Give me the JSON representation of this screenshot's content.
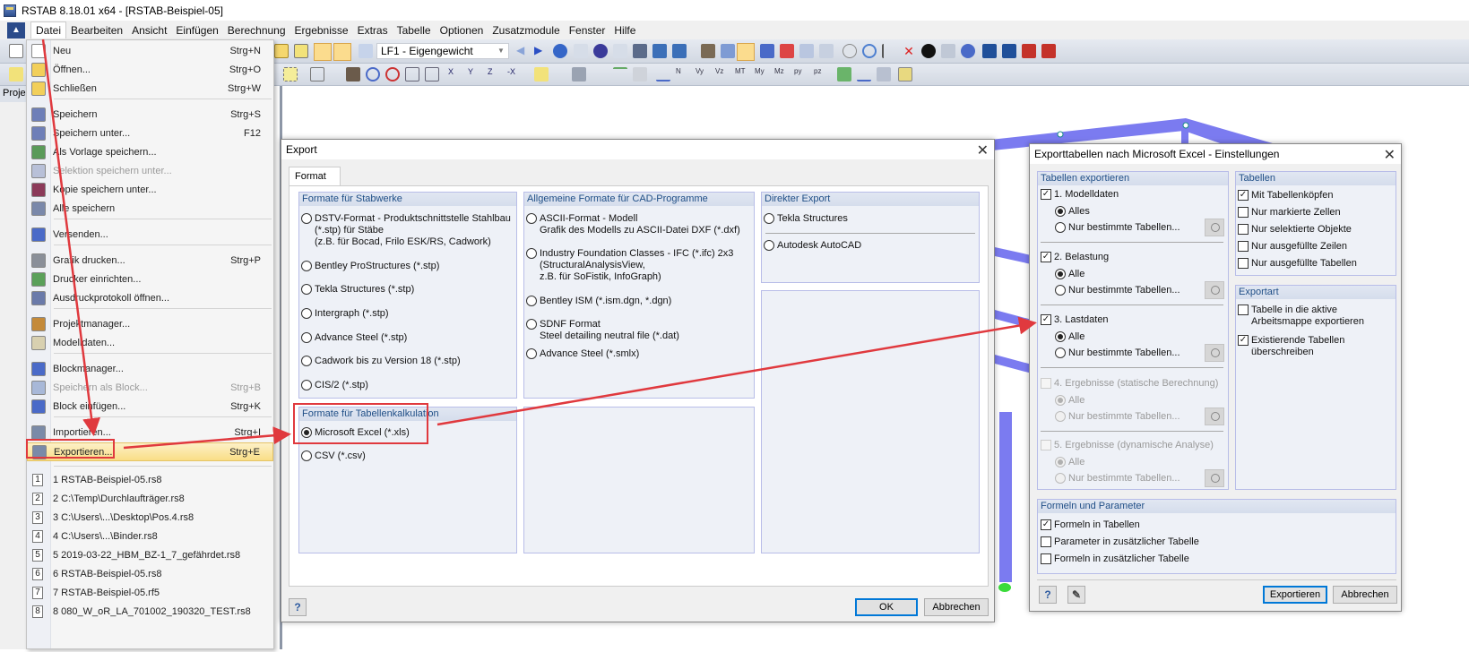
{
  "window": {
    "title": "RSTAB 8.18.01 x64 - [RSTAB-Beispiel-05]"
  },
  "menubar": {
    "items": [
      "Datei",
      "Bearbeiten",
      "Ansicht",
      "Einfügen",
      "Berechnung",
      "Ergebnisse",
      "Extras",
      "Tabelle",
      "Optionen",
      "Zusatzmodule",
      "Fenster",
      "Hilfe"
    ],
    "active": "Datei"
  },
  "toolbar": {
    "loadcase_combo": "LF1 - Eigengewicht"
  },
  "leftpanel": {
    "tab_label": "Proje"
  },
  "filemenu": {
    "items": [
      {
        "label": "Neu",
        "shortcut": "Strg+N",
        "icon": "new-file-icon"
      },
      {
        "label": "Öffnen...",
        "shortcut": "Strg+O",
        "icon": "open-folder-icon"
      },
      {
        "label": "Schließen",
        "shortcut": "Strg+W",
        "icon": "close-folder-icon"
      },
      {
        "label": "Speichern",
        "shortcut": "Strg+S",
        "icon": "save-icon"
      },
      {
        "label": "Speichern unter...",
        "shortcut": "F12",
        "icon": "save-as-icon"
      },
      {
        "label": "Als Vorlage speichern...",
        "shortcut": "",
        "icon": "save-template-icon"
      },
      {
        "label": "Selektion speichern unter...",
        "shortcut": "",
        "icon": "save-selection-icon",
        "disabled": true
      },
      {
        "label": "Kopie speichern unter...",
        "shortcut": "",
        "icon": "save-copy-icon"
      },
      {
        "label": "Alle speichern",
        "shortcut": "",
        "icon": "save-all-icon"
      },
      {
        "label": "Versenden...",
        "shortcut": "",
        "icon": "send-icon"
      },
      {
        "label": "Grafik drucken...",
        "shortcut": "Strg+P",
        "icon": "print-icon"
      },
      {
        "label": "Drucker einrichten...",
        "shortcut": "",
        "icon": "printer-setup-icon"
      },
      {
        "label": "Ausdruckprotokoll öffnen...",
        "shortcut": "",
        "icon": "printout-report-icon"
      },
      {
        "label": "Projektmanager...",
        "shortcut": "",
        "icon": "project-manager-icon"
      },
      {
        "label": "Modelldaten...",
        "shortcut": "",
        "icon": "model-data-icon"
      },
      {
        "label": "Blockmanager...",
        "shortcut": "",
        "icon": "block-manager-icon"
      },
      {
        "label": "Speichern als Block...",
        "shortcut": "Strg+B",
        "icon": "save-block-icon",
        "disabled": true
      },
      {
        "label": "Block einfügen...",
        "shortcut": "Strg+K",
        "icon": "insert-block-icon"
      },
      {
        "label": "Importieren...",
        "shortcut": "Strg+I",
        "icon": "import-icon"
      },
      {
        "label": "Exportieren...",
        "shortcut": "Strg+E",
        "icon": "export-icon",
        "highlighted": true
      }
    ],
    "recent": [
      "1 RSTAB-Beispiel-05.rs8",
      "2 C:\\Temp\\Durchlaufträger.rs8",
      "3 C:\\Users\\...\\Desktop\\Pos.4.rs8",
      "4 C:\\Users\\...\\Binder.rs8",
      "5 2019-03-22_HBM_BZ-1_7_gefährdet.rs8",
      "6 RSTAB-Beispiel-05.rs8",
      "7 RSTAB-Beispiel-05.rf5",
      "8 080_W_oR_LA_701002_190320_TEST.rs8"
    ]
  },
  "export_dialog": {
    "title": "Export",
    "tab": "Format",
    "groups": {
      "stabwerke": {
        "title": "Formate für Stabwerke",
        "options": [
          "DSTV-Format - Produktschnittstelle Stahlbau\n(*.stp) für Stäbe\n(z.B. für Bocad, Frilo ESK/RS, Cadwork)",
          "Bentley ProStructures (*.stp)",
          "Tekla Structures (*.stp)",
          "Intergraph (*.stp)",
          "Advance Steel (*.stp)",
          "Cadwork bis zu Version 18 (*.stp)",
          "CIS/2 (*.stp)"
        ]
      },
      "cad": {
        "title": "Allgemeine Formate für CAD-Programme",
        "options": [
          "ASCII-Format - Modell\nGrafik des Modells zu ASCII-Datei DXF (*.dxf)",
          "Industry Foundation Classes - IFC (*.ifc) 2x3\n(StructuralAnalysisView,\nz.B. für SoFistik, InfoGraph)",
          "Bentley ISM (*.ism.dgn, *.dgn)",
          "SDNF Format\nSteel detailing neutral file (*.dat)",
          "Advance Steel (*.smlx)"
        ]
      },
      "direkt": {
        "title": "Direkter Export",
        "options": [
          "Tekla Structures",
          "Autodesk AutoCAD"
        ]
      },
      "tabellen": {
        "title": "Formate für Tabellenkalkulation",
        "options": [
          "Microsoft Excel (*.xls)",
          "CSV (*.csv)"
        ],
        "selected": "Microsoft Excel (*.xls)"
      }
    },
    "ok": "OK",
    "cancel": "Abbrechen"
  },
  "excel_dialog": {
    "title": "Exporttabellen nach Microsoft Excel - Einstellungen",
    "tabellen_exportieren": {
      "title": "Tabellen exportieren",
      "sections": [
        {
          "label": "1. Modelldaten",
          "checked": true,
          "disabled": false,
          "all_label": "Alles",
          "some_label": "Nur bestimmte Tabellen...",
          "all_selected": true
        },
        {
          "label": "2. Belastung",
          "checked": true,
          "disabled": false,
          "all_label": "Alle",
          "some_label": "Nur bestimmte Tabellen...",
          "all_selected": true
        },
        {
          "label": "3. Lastdaten",
          "checked": true,
          "disabled": false,
          "all_label": "Alle",
          "some_label": "Nur bestimmte Tabellen...",
          "all_selected": true
        },
        {
          "label": "4. Ergebnisse (statische Berechnung)",
          "checked": false,
          "disabled": true,
          "all_label": "Alle",
          "some_label": "Nur bestimmte Tabellen...",
          "all_selected": true
        },
        {
          "label": "5. Ergebnisse (dynamische Analyse)",
          "checked": false,
          "disabled": true,
          "all_label": "Alle",
          "some_label": "Nur bestimmte Tabellen...",
          "all_selected": true
        }
      ]
    },
    "tabellen": {
      "title": "Tabellen",
      "options": [
        {
          "label": "Mit Tabellenköpfen",
          "checked": true
        },
        {
          "label": "Nur markierte Zellen",
          "checked": false
        },
        {
          "label": "Nur selektierte Objekte",
          "checked": false
        },
        {
          "label": "Nur ausgefüllte Zeilen",
          "checked": false
        },
        {
          "label": "Nur ausgefüllte Tabellen",
          "checked": false
        }
      ]
    },
    "exportart": {
      "title": "Exportart",
      "options": [
        {
          "label": "Tabelle in die aktive\nArbeitsmappe exportieren",
          "checked": false
        },
        {
          "label": "Existierende Tabellen\nüberschreiben",
          "checked": true
        }
      ]
    },
    "formeln": {
      "title": "Formeln und Parameter",
      "options": [
        {
          "label": "Formeln in Tabellen",
          "checked": true
        },
        {
          "label": "Parameter in zusätzlicher Tabelle",
          "checked": false
        },
        {
          "label": "Formeln in zusätzlicher Tabelle",
          "checked": false
        }
      ]
    },
    "export_button": "Exportieren",
    "cancel_button": "Abbrechen"
  },
  "colors": {
    "annotation_red": "#e0393e",
    "group_header_text": "#1f4e86",
    "highlight": "#f9de86",
    "structure_blue": "#7b7bf0",
    "default_button_border": "#0078d7"
  }
}
